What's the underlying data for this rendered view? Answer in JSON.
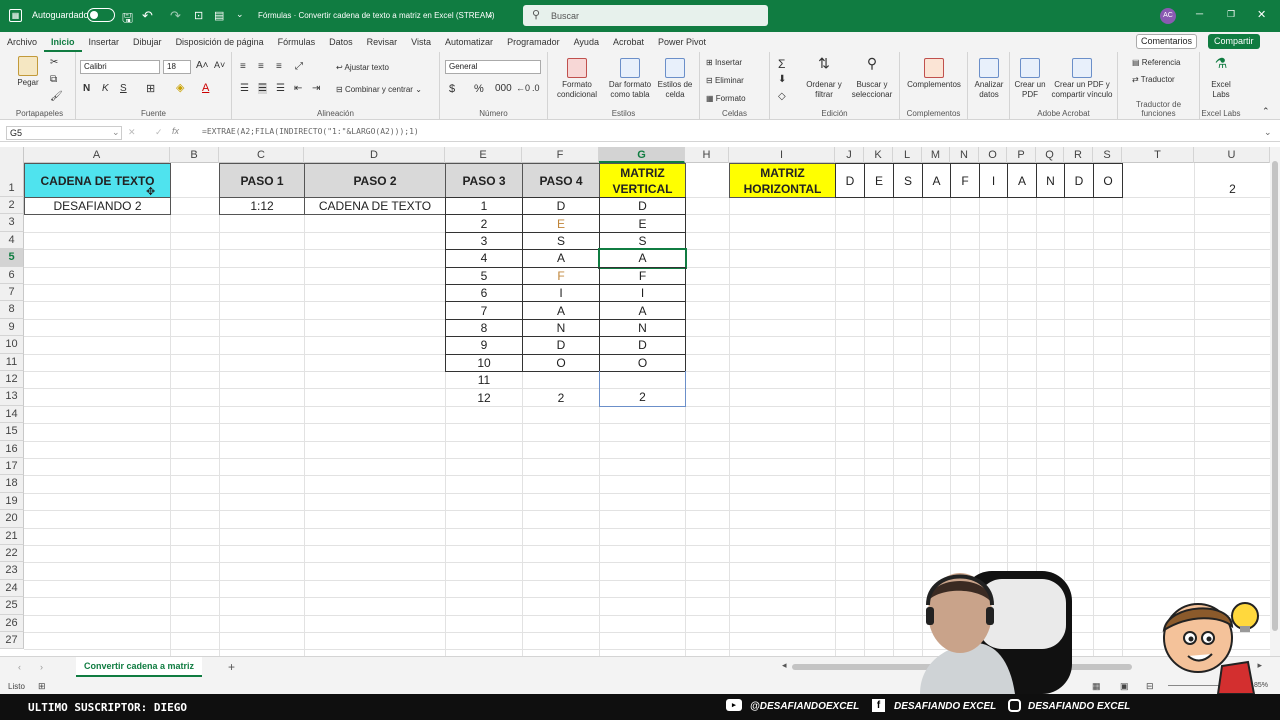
{
  "titlebar": {
    "autosave_label": "Autoguardado",
    "doc_title": "Fórmulas · Convertir cadena de texto a matriz en Excel (STREAM)",
    "search_placeholder": "Buscar",
    "user_initials": "AC"
  },
  "menu": {
    "tabs": [
      "Archivo",
      "Inicio",
      "Insertar",
      "Dibujar",
      "Disposición de página",
      "Fórmulas",
      "Datos",
      "Revisar",
      "Vista",
      "Automatizar",
      "Programador",
      "Ayuda",
      "Acrobat",
      "Power Pivot"
    ],
    "comments_label": "Comentarios",
    "share_label": "Compartir"
  },
  "ribbon": {
    "clipboard": {
      "paste": "Pegar",
      "group": "Portapapeles"
    },
    "font": {
      "name": "Calibri",
      "size": "18",
      "group": "Fuente"
    },
    "alignment": {
      "wrap": "Ajustar texto",
      "merge": "Combinar y centrar",
      "group": "Alineación"
    },
    "number": {
      "format": "General",
      "group": "Número"
    },
    "styles": {
      "conditional": "Formato condicional",
      "as_table": "Dar formato como tabla",
      "cell_styles": "Estilos de celda",
      "group": "Estilos"
    },
    "cells": {
      "insert": "Insertar",
      "delete": "Eliminar",
      "format": "Formato",
      "group": "Celdas"
    },
    "editing": {
      "sort": "Ordenar y filtrar",
      "find": "Buscar y seleccionar",
      "group": "Edición"
    },
    "addins": {
      "label": "Complementos",
      "group": "Complementos"
    },
    "analyze": {
      "label": "Analizar datos"
    },
    "acrobat": {
      "create_pdf": "Crear un PDF",
      "create_share": "Crear un PDF y compartir vínculo",
      "group": "Adobe Acrobat"
    },
    "translator": {
      "reference": "Referencia",
      "translator": "Traductor",
      "group": "Traductor de funciones"
    },
    "labs": {
      "label": "Excel Labs",
      "group": "Excel Labs"
    }
  },
  "formula_bar": {
    "name_box": "G5",
    "fx": "fx",
    "formula": "=EXTRAE(A2;FILA(INDIRECTO(\"1:\"&LARGO(A2)));1)"
  },
  "grid": {
    "columns": [
      "A",
      "B",
      "C",
      "D",
      "E",
      "F",
      "G",
      "H",
      "I",
      "J",
      "K",
      "L",
      "M",
      "N",
      "O",
      "P",
      "Q",
      "R",
      "S",
      "T",
      "U"
    ],
    "rows": [
      "1",
      "2",
      "3",
      "4",
      "5",
      "6",
      "7",
      "8",
      "9",
      "10",
      "11",
      "12",
      "13",
      "14",
      "15",
      "16",
      "17",
      "18",
      "19",
      "20",
      "21",
      "22",
      "23",
      "24",
      "25",
      "26",
      "27"
    ],
    "selected_col": "G",
    "selected_row": "5"
  },
  "cells": {
    "A1": "CADENA DE TEXTO",
    "A2": "DESAFIANDO 2",
    "C1": "PASO 1",
    "C2": "1:12",
    "D1": "PASO 2",
    "D2": "CADENA DE TEXTO",
    "E1": "PASO 3",
    "F1": "PASO 4",
    "G1": "MATRIZ VERTICAL",
    "I1": "MATRIZ HORIZONTAL",
    "U1": "2",
    "E": [
      "1",
      "2",
      "3",
      "4",
      "5",
      "6",
      "7",
      "8",
      "9",
      "10",
      "11",
      "12"
    ],
    "F": [
      "D",
      "E",
      "S",
      "A",
      "F",
      "I",
      "A",
      "N",
      "D",
      "O",
      "",
      "2"
    ],
    "G": [
      "D",
      "E",
      "S",
      "A",
      "F",
      "I",
      "A",
      "N",
      "D",
      "O",
      "",
      "2"
    ],
    "horizontal": [
      "D",
      "E",
      "S",
      "A",
      "F",
      "I",
      "A",
      "N",
      "D",
      "O"
    ]
  },
  "colors": {
    "excel_green": "#107c41",
    "a1_fill": "#4fe3ee",
    "g1_fill": "#ffff00",
    "i1_fill": "#ffff00",
    "header_fill": "#d9d9d9",
    "soft_letter": "#c0853a"
  },
  "sheet_tab": "Convertir cadena a matriz",
  "status": {
    "ready": "Listo",
    "zoom": "85%"
  },
  "stream": {
    "last_sub": "ULTIMO SUSCRIPTOR: DIEGO",
    "youtube": "@DESAFIANDOEXCEL",
    "facebook": "DESAFIANDO EXCEL",
    "instagram": "DESAFIANDO EXCEL"
  }
}
